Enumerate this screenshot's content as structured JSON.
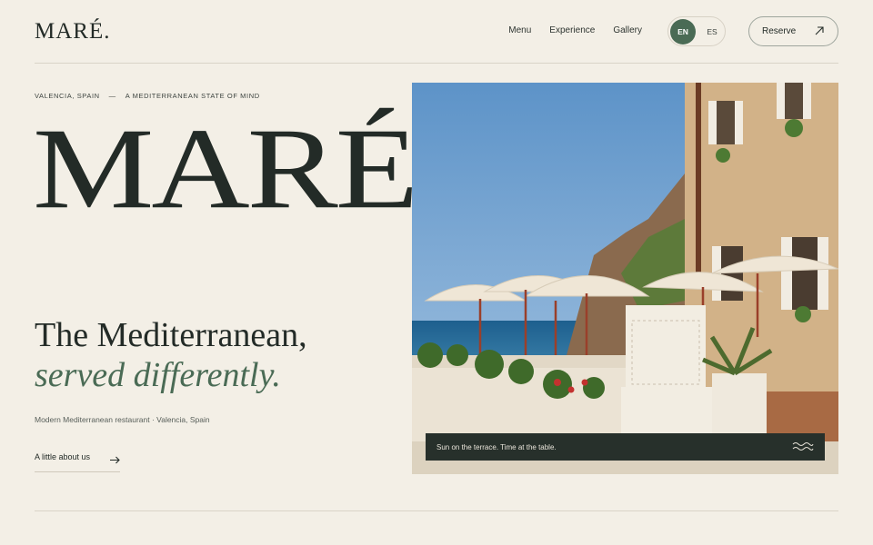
{
  "header": {
    "logo": "MARÉ.",
    "nav": [
      "Menu",
      "Experience",
      "Gallery"
    ],
    "lang": {
      "active": "EN",
      "inactive": "ES"
    },
    "reserve_label": "Reserve"
  },
  "hero": {
    "location": "VALENCIA, SPAIN",
    "separator": "—",
    "tagline": "A MEDITERRANEAN STATE OF MIND",
    "title": "MARÉ",
    "headline_1": "The Mediterranean,",
    "headline_2": "served differently.",
    "subline": "Modern Mediterranean restaurant · Valencia, Spain",
    "about_label": "A little about us"
  },
  "photo": {
    "caption": "Sun on the terrace. Time at the table."
  },
  "icons": {
    "reserve": "arrow-up-right-icon",
    "about": "arrow-right-icon",
    "caption": "waves-icon"
  },
  "colors": {
    "background": "#f3efe6",
    "text": "#232b27",
    "accent": "#4a6b55",
    "caption_bg": "#27302b"
  }
}
